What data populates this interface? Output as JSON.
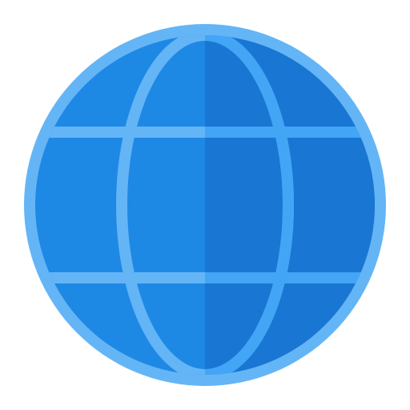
{
  "icon": {
    "name": "globe-icon",
    "colors": {
      "background": "#ffffff",
      "outline": "#64b5f6",
      "fill_left": "#1e88e5",
      "fill_right": "#1976d2",
      "grid_left": "#64b5f6",
      "grid_right": "#42a5f5"
    }
  }
}
